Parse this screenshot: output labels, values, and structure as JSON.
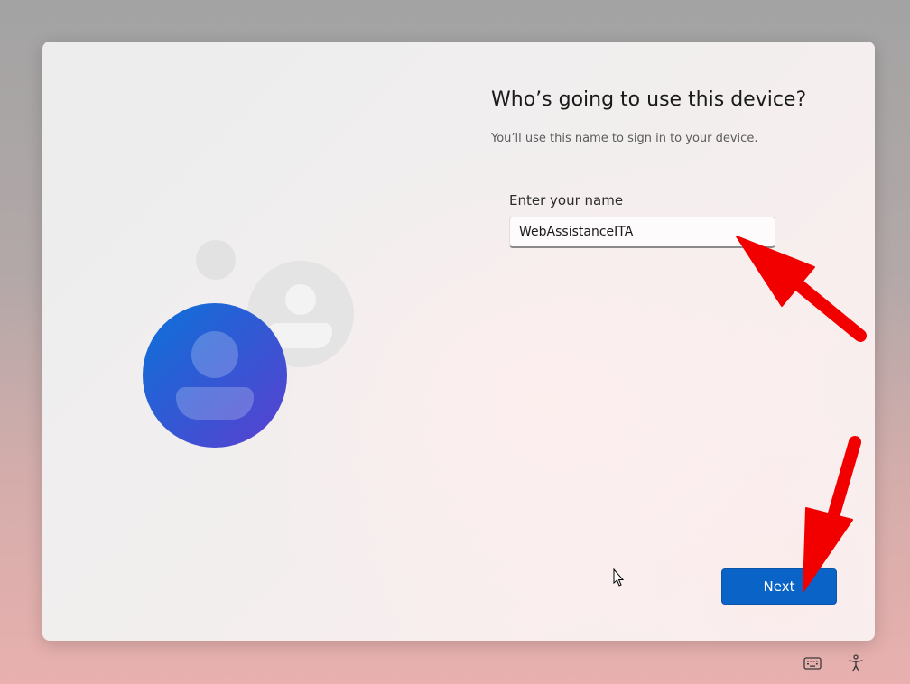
{
  "dialog": {
    "title": "Who’s going to use this device?",
    "subtitle": "You’ll use this name to sign in to your device.",
    "name_label": "Enter your name",
    "name_value": "WebAssistanceITA",
    "next_label": "Next"
  },
  "icons": {
    "main_avatar": "user-avatar-icon",
    "secondary_avatar": "secondary-user-icon",
    "keyboard": "keyboard-icon",
    "accessibility": "accessibility-icon",
    "cursor": "mouse-cursor-icon"
  },
  "colors": {
    "accent": "#0a63c6",
    "annotation_arrow": "#f20000",
    "avatar_gradient_start": "#0b6fd6",
    "avatar_gradient_end": "#5a3fd0"
  }
}
